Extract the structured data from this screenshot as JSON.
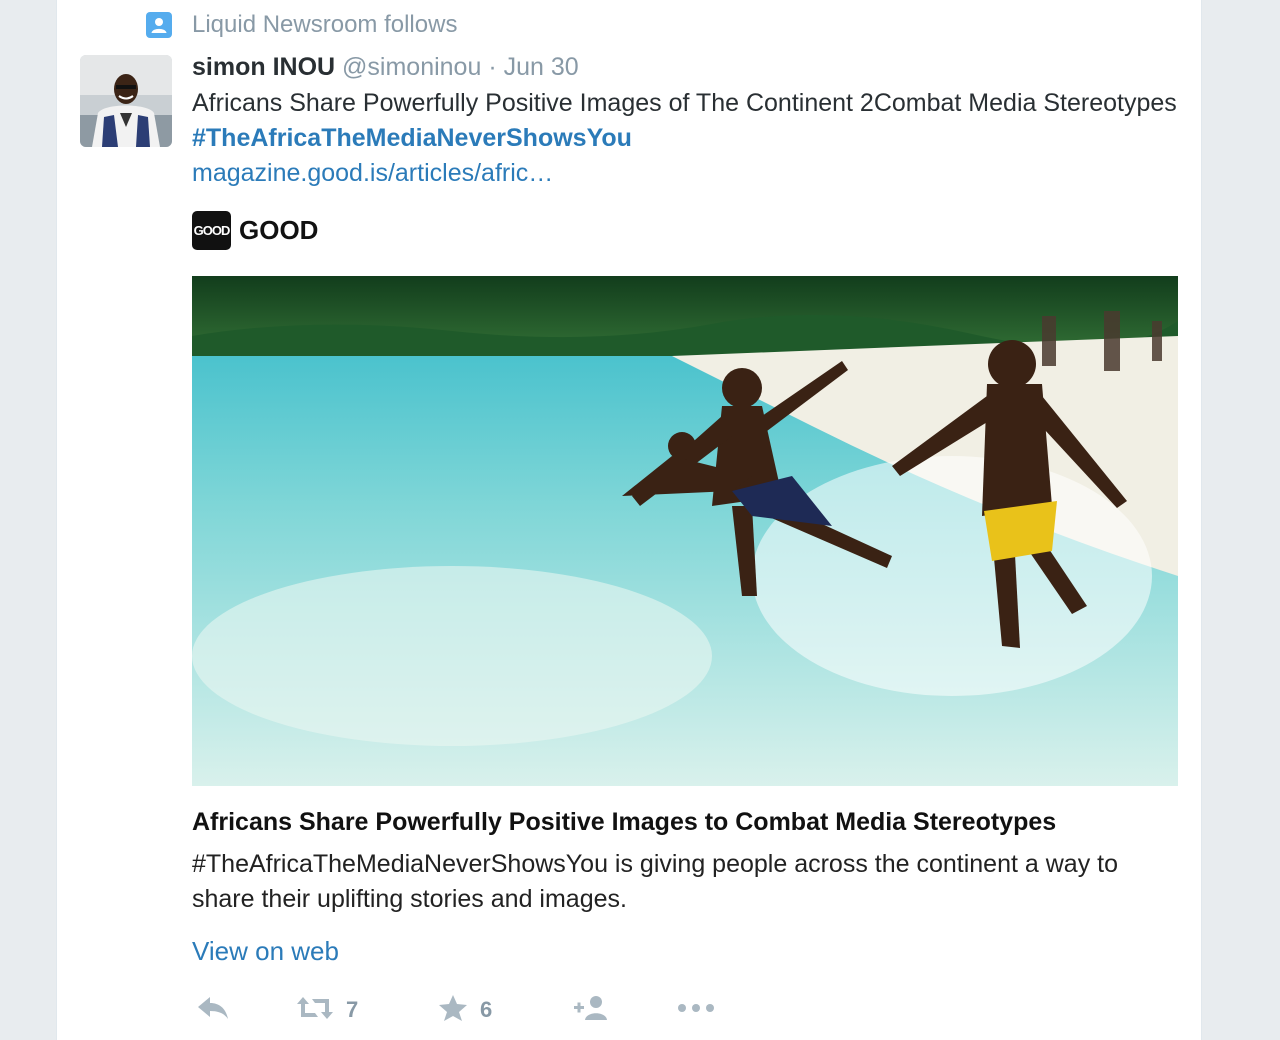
{
  "context": {
    "label": "Liquid Newsroom follows"
  },
  "tweet": {
    "name": "simon INOU",
    "handle": "@simoninou",
    "separator": "·",
    "time": "Jun 30",
    "text": "Africans Share Powerfully Positive Images of The Continent 2Combat Media Stereotypes",
    "hashtag": "#TheAfricaTheMediaNeverShowsYou",
    "link": "magazine.good.is/articles/afric…"
  },
  "card": {
    "source_logo": "GOOD",
    "source_name": "GOOD",
    "title": "Africans Share Powerfully Positive Images to Combat Media Stereotypes",
    "description": "#TheAfricaTheMediaNeverShowsYou is giving people across the continent a way to share their uplifting stories and images.",
    "view_on_web": "View on web"
  },
  "actions": {
    "reply_icon": "reply-icon",
    "retweet_icon": "retweet-icon",
    "retweet_count": "7",
    "favorite_icon": "star-icon",
    "favorite_count": "6",
    "follow_icon": "follow-icon",
    "more_icon": "more-icon"
  },
  "colors": {
    "link": "#2b7bb9",
    "muted": "#8899a6",
    "action_gray": "#aab8c2",
    "context_icon": "#55acee"
  }
}
